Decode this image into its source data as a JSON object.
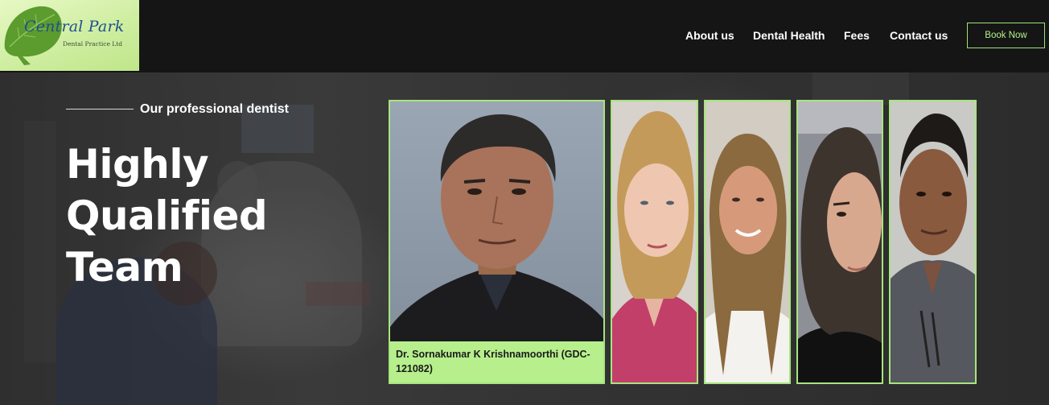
{
  "brand": {
    "line1": "Central Park",
    "line2": "Dental Practice Ltd"
  },
  "nav": {
    "items": [
      "About us",
      "Dental Health",
      "Fees",
      "Contact us"
    ],
    "book_label": "Book Now"
  },
  "hero": {
    "eyebrow": "Our professional dentist",
    "headline": [
      "Highly",
      "Qualified",
      "Team"
    ]
  },
  "team": {
    "featured_caption": "Dr. Sornakumar K Krishnamoorthi (GDC-121082)"
  },
  "colors": {
    "accent": "#a6e57f",
    "caption_bg": "#b7ef8c",
    "header_bg": "#151515"
  }
}
